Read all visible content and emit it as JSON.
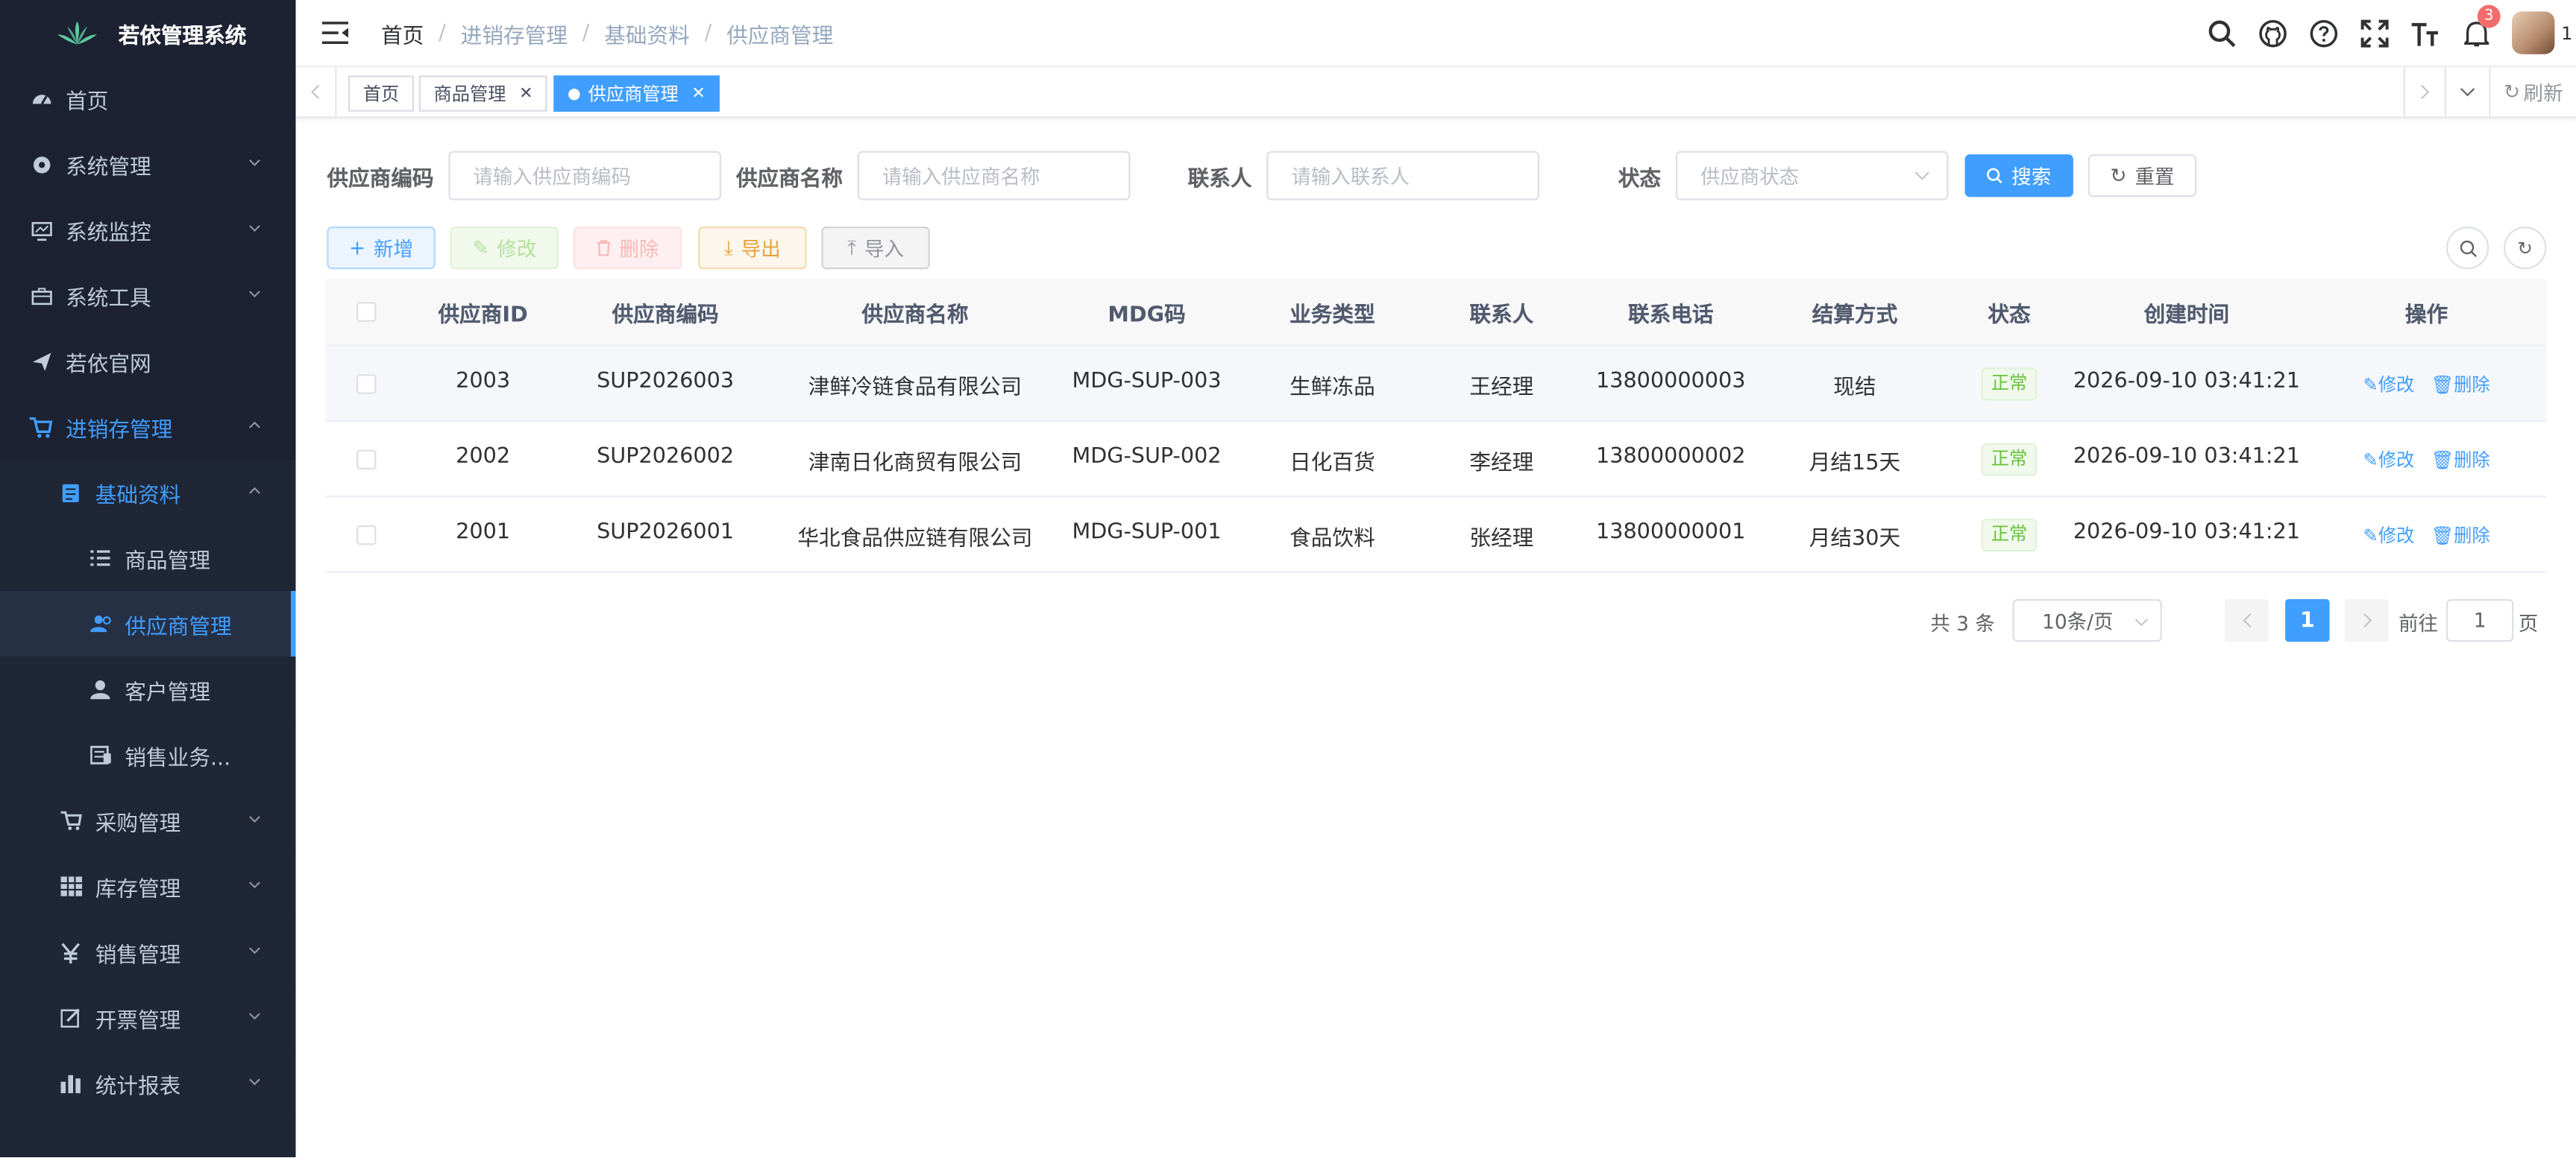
{
  "app": {
    "title": "若依管理系统"
  },
  "sidebar": {
    "items": [
      {
        "label": "首页",
        "icon": "dashboard-icon"
      },
      {
        "label": "系统管理",
        "icon": "gear-icon"
      },
      {
        "label": "系统监控",
        "icon": "monitor-icon"
      },
      {
        "label": "系统工具",
        "icon": "toolbox-icon"
      },
      {
        "label": "若依官网",
        "icon": "send-icon"
      },
      {
        "label": "进销存管理",
        "icon": "cart-icon"
      },
      {
        "label": "基础资料",
        "icon": "document-icon"
      },
      {
        "label": "商品管理",
        "icon": "list-icon"
      },
      {
        "label": "供应商管理",
        "icon": "peoples-icon"
      },
      {
        "label": "客户管理",
        "icon": "user-icon"
      },
      {
        "label": "销售业务...",
        "icon": "invoice-icon"
      },
      {
        "label": "采购管理",
        "icon": "cart-icon"
      },
      {
        "label": "库存管理",
        "icon": "grid-icon"
      },
      {
        "label": "销售管理",
        "icon": "yen-icon"
      },
      {
        "label": "开票管理",
        "icon": "edit-icon"
      },
      {
        "label": "统计报表",
        "icon": "chart-icon"
      }
    ]
  },
  "navbar": {
    "breadcrumb": [
      "首页",
      "进销存管理",
      "基础资料",
      "供应商管理"
    ],
    "notification_count": "3",
    "user_label": "1"
  },
  "tags": {
    "items": [
      "首页",
      "商品管理",
      "供应商管理"
    ],
    "refresh": "刷新"
  },
  "search": {
    "code_label": "供应商编码",
    "code_placeholder": "请输入供应商编码",
    "name_label": "供应商名称",
    "name_placeholder": "请输入供应商名称",
    "contact_label": "联系人",
    "contact_placeholder": "请输入联系人",
    "status_label": "状态",
    "status_placeholder": "供应商状态",
    "search_btn": "搜索",
    "reset_btn": "重置"
  },
  "toolbar": {
    "add": "新增",
    "edit": "修改",
    "delete": "删除",
    "export": "导出",
    "import": "导入"
  },
  "table": {
    "headers": [
      "供应商ID",
      "供应商编码",
      "供应商名称",
      "MDG码",
      "业务类型",
      "联系人",
      "联系电话",
      "结算方式",
      "状态",
      "创建时间",
      "操作"
    ],
    "rows": [
      {
        "id": "2003",
        "code": "SUP2026003",
        "name": "津鲜冷链食品有限公司",
        "mdg": "MDG-SUP-003",
        "type": "生鲜冻品",
        "contact": "王经理",
        "phone": "13800000003",
        "settle": "现结",
        "status": "正常",
        "created": "2026-09-10 03:41:21"
      },
      {
        "id": "2002",
        "code": "SUP2026002",
        "name": "津南日化商贸有限公司",
        "mdg": "MDG-SUP-002",
        "type": "日化百货",
        "contact": "李经理",
        "phone": "13800000002",
        "settle": "月结15天",
        "status": "正常",
        "created": "2026-09-10 03:41:21"
      },
      {
        "id": "2001",
        "code": "SUP2026001",
        "name": "华北食品供应链有限公司",
        "mdg": "MDG-SUP-001",
        "type": "食品饮料",
        "contact": "张经理",
        "phone": "13800000001",
        "settle": "月结30天",
        "status": "正常",
        "created": "2026-09-10 03:41:21"
      }
    ],
    "op_edit": "修改",
    "op_delete": "删除"
  },
  "pagination": {
    "total": "共 3 条",
    "page_size": "10条/页",
    "current": "1",
    "goto_label": "前往",
    "goto_value": "1",
    "page_suffix": "页"
  },
  "colors": {
    "primary": "#409eff",
    "sidebar_bg": "#1c2232",
    "success": "#67c23a"
  }
}
